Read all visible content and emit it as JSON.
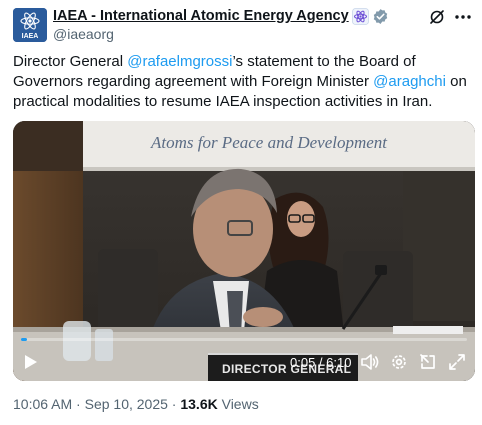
{
  "author": {
    "display_name": "IAEA - International Atomic Energy Agency",
    "handle": "@iaeaorg",
    "avatar_label": "IAEA",
    "affiliation_icon": "atom-icon",
    "verified_icon": "verified-badge-icon"
  },
  "actions": {
    "grok_icon": "grok-icon",
    "more_icon": "more-icon"
  },
  "post": {
    "text_1": "Director General ",
    "mention_1": "@rafaelmgrossi",
    "text_2": "’s statement to the Board of Governors regarding agreement with Foreign Minister ",
    "mention_2": "@araghchi",
    "text_3": " on practical modalities to resume IAEA inspection activities in Iran."
  },
  "video": {
    "banner": "Atoms for Peace and Development",
    "nameplate": "DIRECTOR GENERAL",
    "elapsed": "0:05",
    "duration": "6:10",
    "time_display": "0:05 / 6:10",
    "progress_fraction": 0.0135
  },
  "meta": {
    "time": "10:06 AM",
    "separator": "·",
    "date": "Sep 10, 2025",
    "views_count": "13.6K",
    "views_label": "Views"
  },
  "colors": {
    "accent": "#1d9bf0",
    "text": "#0f1419",
    "secondary": "#536471",
    "avatar_bg": "#2a5b9c"
  }
}
